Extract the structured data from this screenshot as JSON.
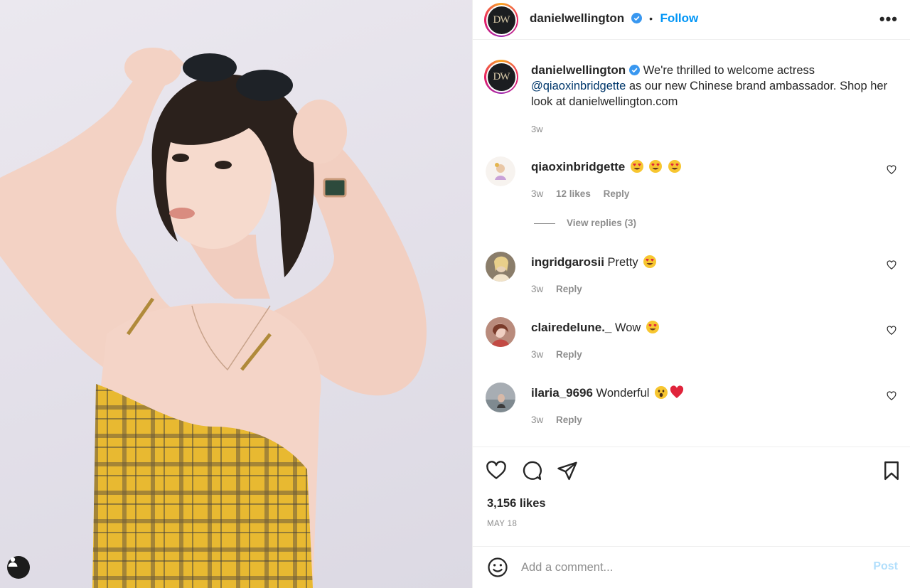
{
  "post": {
    "author": "danielwellington",
    "avatar_initials": "DW",
    "follow_label": "Follow",
    "dot": "•",
    "more_label": "•••",
    "caption_author": "danielwellington",
    "caption_text_before": " We're thrilled to welcome actress ",
    "caption_mention": "@qiaoxinbridgette",
    "caption_text_after": " as our new Chinese brand ambassador. Shop her look at danielwellington.com",
    "caption_time": "3w",
    "likes": "3,156 likes",
    "date": "MAY 18"
  },
  "comments": [
    {
      "user": "qiaoxinbridgette",
      "text": "",
      "emoji": [
        "heart-eyes",
        "heart-eyes",
        "heart-eyes"
      ],
      "time": "3w",
      "likes": "12 likes",
      "reply": "Reply",
      "view_replies": "View replies (3)"
    },
    {
      "user": "ingridgarosii",
      "text": " Pretty ",
      "emoji": [
        "heart-eyes"
      ],
      "time": "3w",
      "reply": "Reply"
    },
    {
      "user": "clairedelune._",
      "text": " Wow ",
      "emoji": [
        "heart-eyes"
      ],
      "time": "3w",
      "reply": "Reply"
    },
    {
      "user": "ilaria_9696",
      "text": " Wonderful ",
      "emoji": [
        "astonished",
        "red-heart"
      ],
      "time": "3w",
      "reply": "Reply"
    }
  ],
  "comment_box": {
    "placeholder": "Add a comment...",
    "post_label": "Post"
  },
  "colors": {
    "link": "#0095f6",
    "mention": "#00376b",
    "muted": "#8e8e8e",
    "post_disabled": "#b2dffc"
  },
  "icons": [
    "user-tag-icon",
    "verified-badge-icon",
    "more-options-icon",
    "heart-icon",
    "comment-icon",
    "share-icon",
    "bookmark-icon",
    "emoji-icon"
  ]
}
